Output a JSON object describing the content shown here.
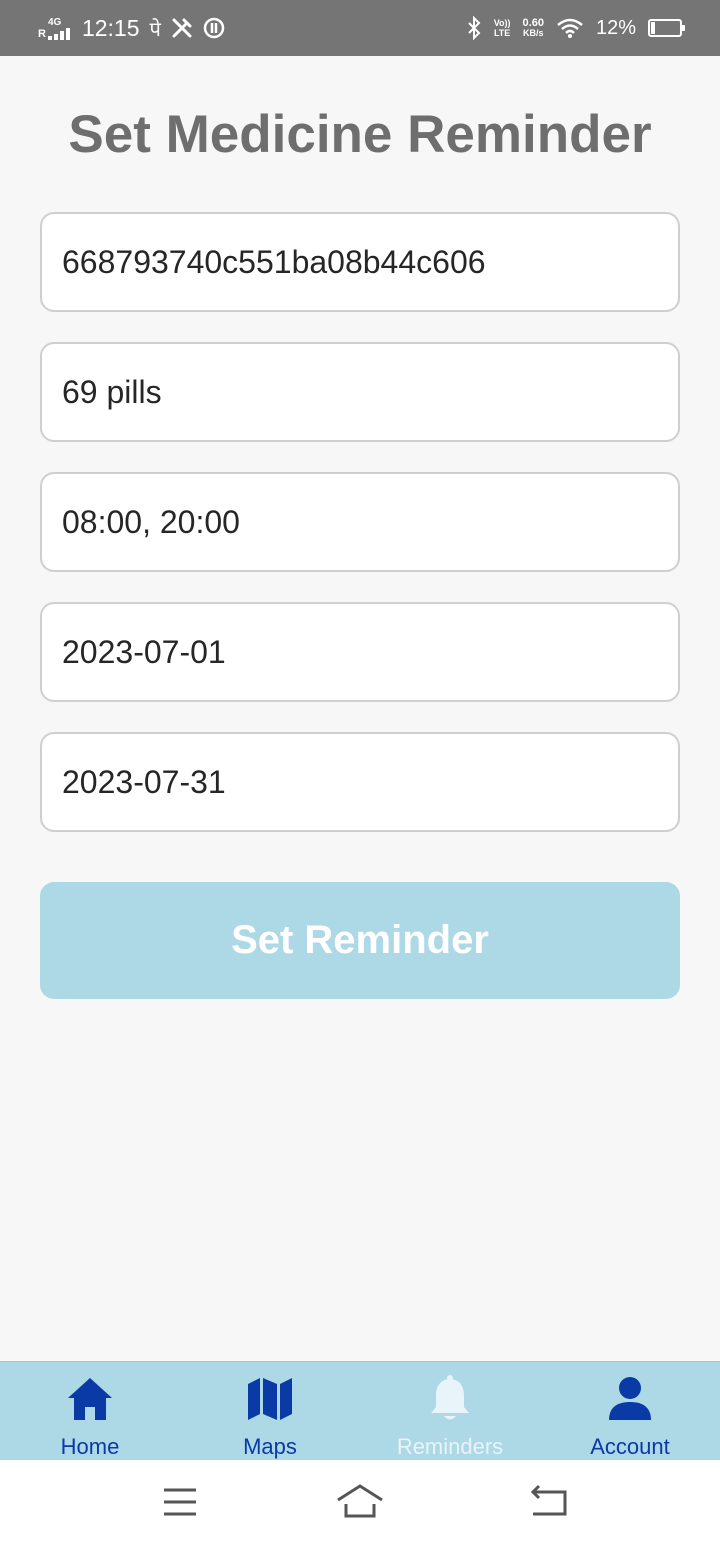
{
  "status_bar": {
    "roaming": "R",
    "network_type": "4G",
    "time": "12:15",
    "notification_glyph": "पे",
    "net_speed_value": "0.60",
    "net_speed_unit": "KB/s",
    "volte_top": "Vo))",
    "volte_bottom": "LTE",
    "battery_percent": "12%",
    "battery_level": 0.12,
    "icons": [
      "signal-icon",
      "tools-icon",
      "data-saver-icon",
      "bluetooth-icon",
      "volte-icon",
      "wifi-icon",
      "battery-icon"
    ]
  },
  "page": {
    "title": "Set Medicine Reminder"
  },
  "form": {
    "medicine_id": "668793740c551ba08b44c606",
    "dosage": "69 pills",
    "times": "08:00, 20:00",
    "start_date": "2023-07-01",
    "end_date": "2023-07-31",
    "submit_label": "Set Reminder"
  },
  "bottom_nav": {
    "items": [
      {
        "label": "Home",
        "icon": "home-icon",
        "active": false
      },
      {
        "label": "Maps",
        "icon": "map-icon",
        "active": false
      },
      {
        "label": "Reminders",
        "icon": "bell-icon",
        "active": true
      },
      {
        "label": "Account",
        "icon": "person-icon",
        "active": false
      }
    ]
  },
  "colors": {
    "status_bar": "#757575",
    "background": "#f7f7f7",
    "title": "#6e6e6e",
    "button": "#add8e6",
    "nav_bar": "#add8e6",
    "nav_icon": "#0a3aa6",
    "nav_active": "#e8f4f9"
  }
}
